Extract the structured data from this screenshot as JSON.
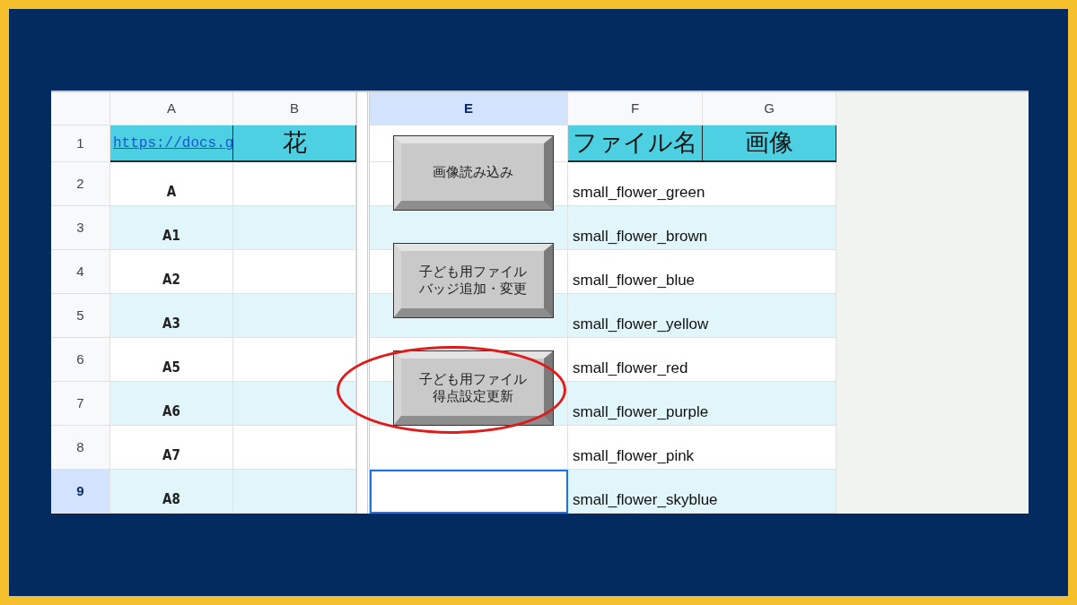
{
  "columns": [
    {
      "label": "A",
      "selected": false
    },
    {
      "label": "B",
      "selected": false
    },
    {
      "label": "E",
      "selected": true
    },
    {
      "label": "F",
      "selected": false
    },
    {
      "label": "G",
      "selected": false
    }
  ],
  "rows": [
    {
      "number": "1",
      "selected": false,
      "kind": "header",
      "link": "https://docs.g",
      "b": "花",
      "f": "ファイル名",
      "g": "画像"
    },
    {
      "number": "2",
      "selected": false,
      "a": "A",
      "f": "small_flower_green"
    },
    {
      "number": "3",
      "selected": false,
      "a": "A1",
      "f": "small_flower_brown"
    },
    {
      "number": "4",
      "selected": false,
      "a": "A2",
      "f": "small_flower_blue"
    },
    {
      "number": "5",
      "selected": false,
      "a": "A3",
      "f": "small_flower_yellow"
    },
    {
      "number": "6",
      "selected": false,
      "a": "A5",
      "f": "small_flower_red"
    },
    {
      "number": "7",
      "selected": false,
      "a": "A6",
      "f": "small_flower_purple"
    },
    {
      "number": "8",
      "selected": false,
      "a": "A7",
      "f": "small_flower_pink"
    },
    {
      "number": "9",
      "selected": true,
      "a": "A8",
      "f": "small_flower_skyblue"
    }
  ],
  "buttons": [
    {
      "lines": [
        "画像読み込み"
      ],
      "circled": false
    },
    {
      "lines": [
        "子ども用ファイル",
        "バッジ追加・変更"
      ],
      "circled": false
    },
    {
      "lines": [
        "子ども用ファイル",
        "得点設定更新"
      ],
      "circled": true
    }
  ]
}
